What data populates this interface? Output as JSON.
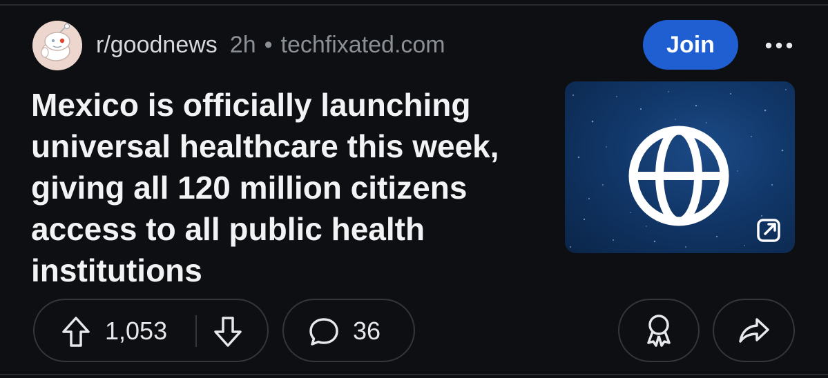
{
  "post": {
    "subreddit": "r/goodnews",
    "age": "2h",
    "separator": "•",
    "domain": "techfixated.com",
    "join_label": "Join",
    "more_label": "•••",
    "title": "Mexico is officially launching universal healthcare this week, giving all 120 million citizens access to all public health institutions",
    "thumbnail_icon": "globe-icon",
    "external_link_icon": "external-link-icon"
  },
  "actions": {
    "upvote_icon": "arrow-up-icon",
    "vote_count": "1,053",
    "downvote_icon": "arrow-down-icon",
    "comment_icon": "comment-bubble-icon",
    "comment_count": "36",
    "award_icon": "award-icon",
    "share_icon": "share-icon"
  },
  "colors": {
    "background": "#0e0f12",
    "join_button": "#1f5fd1",
    "meta_text": "#8b8f96",
    "thumbnail_blue": "#113769"
  }
}
